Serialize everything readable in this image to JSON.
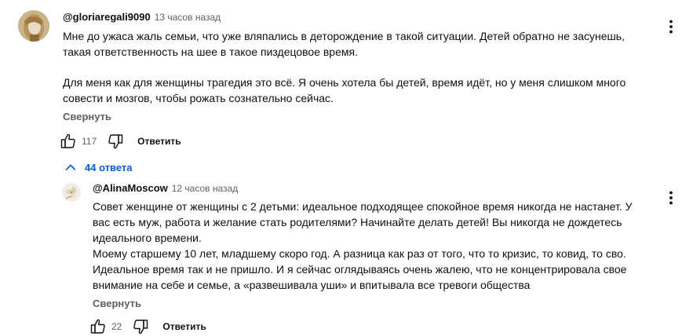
{
  "comments": [
    {
      "author": "@gloriaregali9090",
      "timestamp": "13 часов назад",
      "text_paragraph_1": "Мне до ужаса жаль семьи, что уже вляпались в деторождение в такой ситуации. Детей обратно не засунешь,\nтакая ответственность на шее в такое пиздецовое время.",
      "text_paragraph_2": "Для меня как для женщины трагедия это всё. Я очень хотела бы детей, время идёт, но у меня слишком много\nсовести и мозгов, чтобы рожать сознательно сейчас.",
      "collapse_label": "Свернуть",
      "like_count": "117",
      "reply_label": "Ответить",
      "avatar_icon": "portrait-avatar",
      "menu_icon": "more-vert-icon"
    }
  ],
  "replies_toggle": {
    "label": "44 ответа",
    "icon": "chevron-up-icon",
    "color": "#065fd4"
  },
  "replies": [
    {
      "author": "@AlinaMoscow",
      "timestamp": "12 часов назад",
      "text": "Совет женщине от женщины с   2 детьми: идеальное подходящее спокойное время никогда не настанет. У\nвас есть муж, работа и желание стать родителями? Начинайте  делать детей! Вы никогда не дождетесь\nидеального времени.\nМоему старшему 10 лет, младшему скоро год. А разница как раз от того, что то кризис, то ковид, то сво.\nИдеальное время так и не пришло. И я сейчас оглядываясь очень жалею, что не концентрировала свое\nвнимание на себе и семье, а «развешивала уши» и впитывала все тревоги общества",
      "collapse_label": "Свернуть",
      "like_count": "22",
      "reply_label": "Ответить",
      "avatar_icon": "flower-avatar",
      "menu_icon": "more-vert-icon"
    }
  ],
  "icons": {
    "like": "thumb-up-icon",
    "dislike": "thumb-down-icon"
  },
  "colors": {
    "text_primary": "#0f0f0f",
    "text_secondary": "#606060",
    "link_blue": "#065fd4"
  }
}
